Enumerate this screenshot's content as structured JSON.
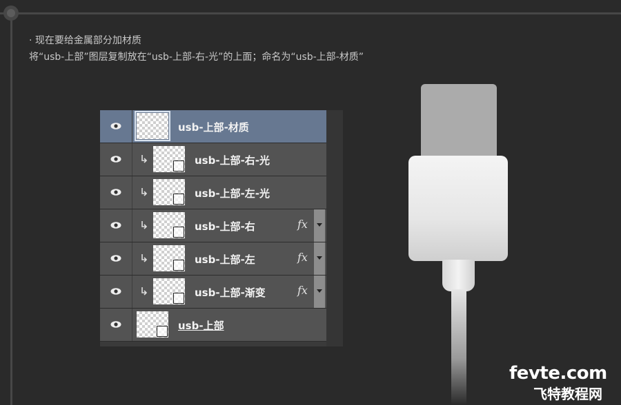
{
  "captions": {
    "line1": "· 现在要给金属部分加材质",
    "line2": "将“usb-上部”图层复制放在“usb-上部-右-光”的上面；命名为“usb-上部-材质”"
  },
  "layers": [
    {
      "name": "usb-上部-材质",
      "selected": true,
      "clipped": false,
      "fx": ""
    },
    {
      "name": "usb-上部-右-光",
      "selected": false,
      "clipped": true,
      "fx": ""
    },
    {
      "name": "usb-上部-左-光",
      "selected": false,
      "clipped": true,
      "fx": ""
    },
    {
      "name": "usb-上部-右",
      "selected": false,
      "clipped": true,
      "fx": "fx"
    },
    {
      "name": "usb-上部-左",
      "selected": false,
      "clipped": true,
      "fx": "fx"
    },
    {
      "name": "usb-上部-渐变",
      "selected": false,
      "clipped": true,
      "fx": "fx"
    },
    {
      "name": "usb-上部",
      "selected": false,
      "clipped": false,
      "fx": ""
    }
  ],
  "watermark": {
    "site": "fevte.com",
    "subtitle": "飞特教程网"
  },
  "colors": {
    "background": "#2a2a2a",
    "selected_layer": "#677891",
    "layer_row": "#535353"
  },
  "icons": {
    "visibility": "eye-icon",
    "clipping": "clip-arrow-icon",
    "effects": "fx-icon"
  }
}
